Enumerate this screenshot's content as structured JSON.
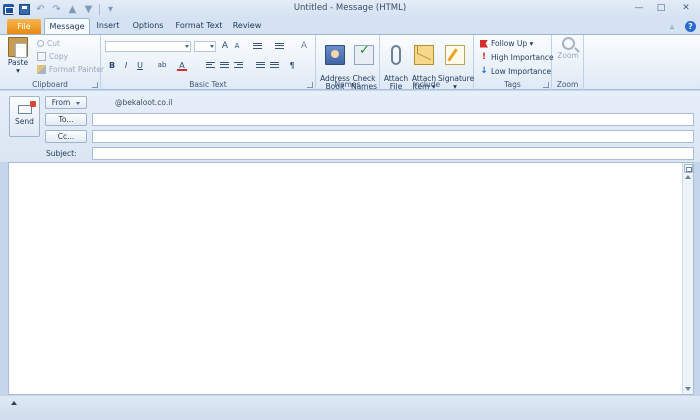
{
  "window": {
    "title": "Untitled - Message (HTML)",
    "controls": {
      "minimize": "—",
      "maximize": "□",
      "close": "✕"
    }
  },
  "quick_access": {
    "undo": "↶",
    "redo": "↷",
    "up": "▲",
    "down": "▼",
    "customize": "▾"
  },
  "tabs": [
    {
      "label": "File"
    },
    {
      "label": "Message"
    },
    {
      "label": "Insert"
    },
    {
      "label": "Options"
    },
    {
      "label": "Format Text"
    },
    {
      "label": "Review"
    }
  ],
  "ribbon": {
    "help": "?",
    "collapse": "▵",
    "clipboard": {
      "group_label": "Clipboard",
      "paste": "Paste",
      "paste_caret": "▾",
      "cut": "Cut",
      "copy": "Copy",
      "format_painter": "Format Painter"
    },
    "basic_text": {
      "group_label": "Basic Text",
      "grow_font": "A",
      "shrink_font": "A",
      "bold": "B",
      "italic": "I",
      "underline": "U",
      "font_color": "A",
      "clear": "A",
      "highlight": "ab",
      "numbering": "¶"
    },
    "names": {
      "group_label": "Names",
      "address_book": "Address\nBook",
      "check_names": "Check\nNames"
    },
    "include": {
      "group_label": "Include",
      "attach_file": "Attach\nFile",
      "attach_item": "Attach\nItem ▾",
      "signature": "Signature\n▾"
    },
    "tags": {
      "group_label": "Tags",
      "follow_up": "Follow Up ▾",
      "high_importance": "High Importance",
      "low_importance": "Low Importance"
    },
    "zoom": {
      "group_label": "Zoom",
      "zoom": "Zoom"
    }
  },
  "header": {
    "send": "Send",
    "from": "From",
    "from_email": "@bekaloot.co.il",
    "to": "To...",
    "cc": "Cc...",
    "subject_label": "Subject:",
    "to_value": "",
    "cc_value": "",
    "subject_value": ""
  },
  "colors": {
    "file_tab": "#e88a13",
    "ribbon_bg": "#dfe9f5",
    "frame": "#c5d6ea"
  }
}
